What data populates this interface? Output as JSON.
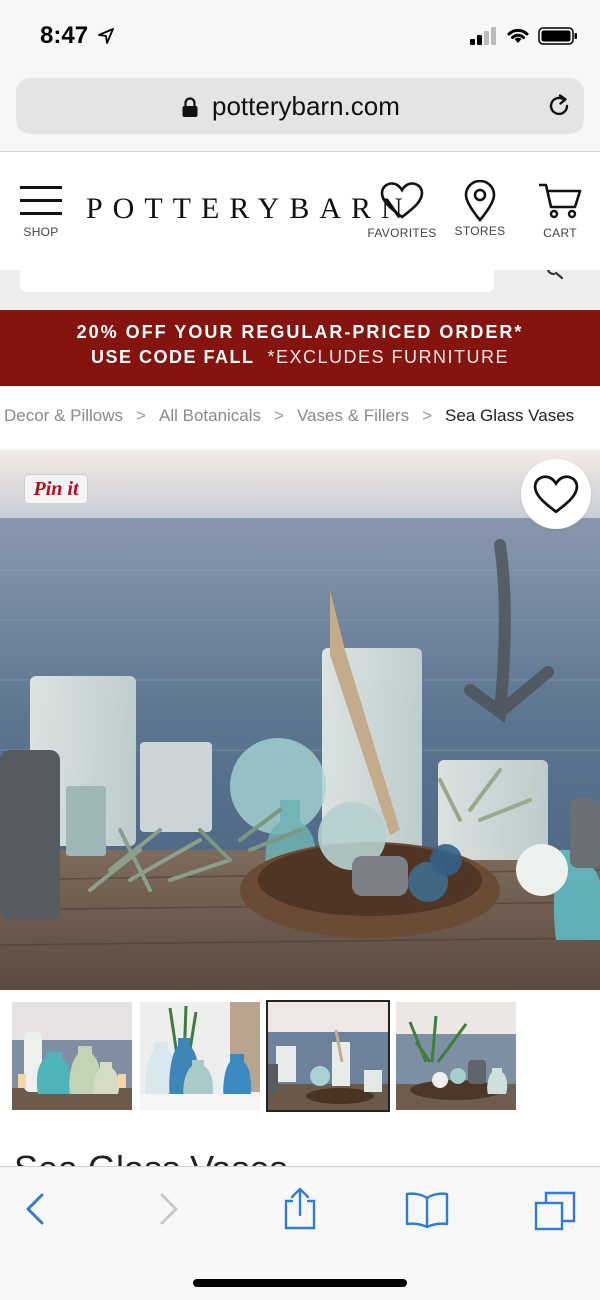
{
  "status_bar": {
    "time": "8:47"
  },
  "browser": {
    "url": "potterybarn.com"
  },
  "header": {
    "logo": "POTTERYBARN",
    "shop_label": "SHOP",
    "favorites_label": "FAVORITES",
    "stores_label": "STORES",
    "cart_label": "CART"
  },
  "promo": {
    "line1": "20% OFF YOUR REGULAR-PRICED ORDER*",
    "code_label": "USE CODE FALL",
    "exclusion": "*EXCLUDES FURNITURE"
  },
  "breadcrumb": {
    "items": [
      "Decor & Pillows",
      "All Botanicals",
      "Vases & Fillers"
    ],
    "current": "Sea Glass Vases",
    "separator": ">"
  },
  "hero": {
    "pin_label": "Pin it"
  },
  "thumbnails": {
    "selected_index": 2,
    "count": 4
  },
  "product": {
    "title": "Sea Glass Vases"
  },
  "colors": {
    "promo_bg": "#85140f",
    "ios_blue": "#2f7cd8",
    "pin_red": "#bd081c"
  }
}
